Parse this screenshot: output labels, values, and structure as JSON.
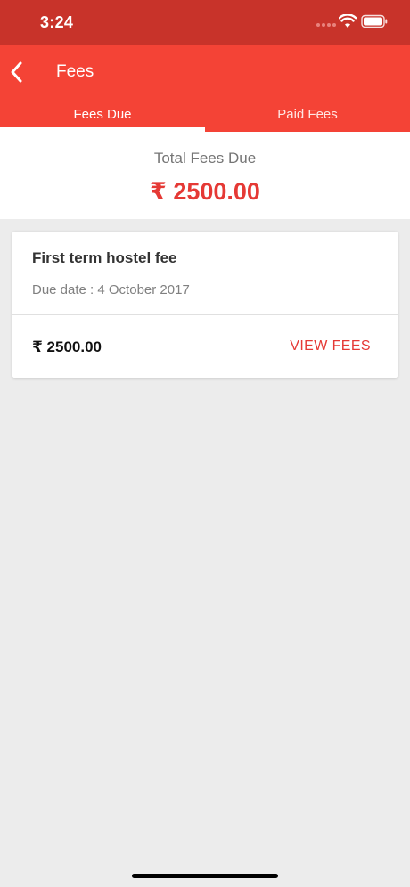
{
  "status_bar": {
    "time": "3:24",
    "icons": [
      "signal-dots-icon",
      "wifi-icon",
      "battery-icon"
    ]
  },
  "app_bar": {
    "title": "Fees",
    "back_icon": "chevron-left-icon"
  },
  "tabs": [
    {
      "label": "Fees Due",
      "active": true
    },
    {
      "label": "Paid Fees",
      "active": false
    }
  ],
  "summary": {
    "label": "Total Fees Due",
    "amount": "₹ 2500.00"
  },
  "fee_items": [
    {
      "name": "First term hostel fee",
      "due_date": "Due date : 4 October 2017",
      "amount": "₹ 2500.00",
      "action_label": "VIEW FEES"
    }
  ],
  "colors": {
    "status_bar": "#c8332a",
    "app_bar": "#f44336",
    "accent": "#e53935",
    "background": "#ececec"
  }
}
